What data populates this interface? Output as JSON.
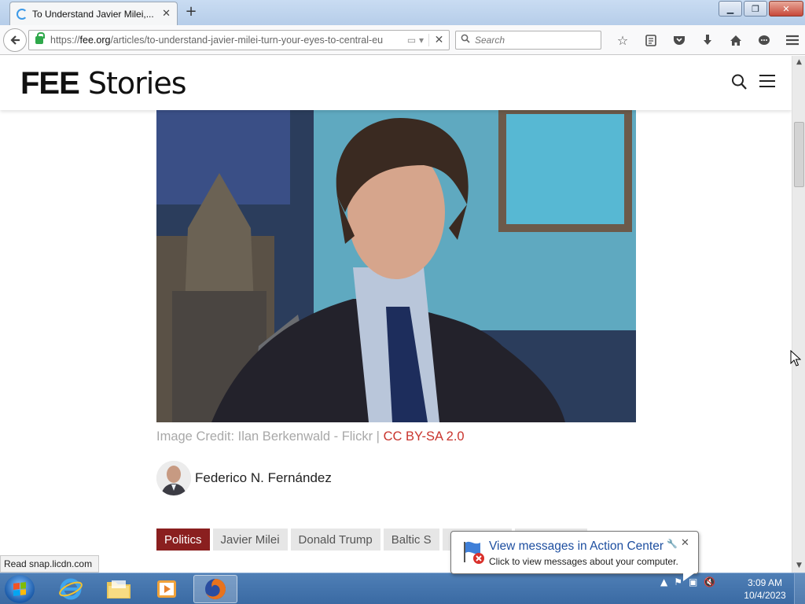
{
  "browser": {
    "tab_title": "To Understand Javier Milei,...",
    "url_prefix": "https://",
    "url_domain": "fee.org",
    "url_path": "/articles/to-understand-javier-milei-turn-your-eyes-to-central-eu",
    "search_placeholder": "Search",
    "status_text": "Read snap.licdn.com"
  },
  "site": {
    "logo_bold": "FEE",
    "logo_light": " Stories"
  },
  "article": {
    "caption_prefix": "Image Credit: Ilan Berkenwald - Flickr | ",
    "caption_license": "CC BY-SA 2.0",
    "author_name": "Federico N. Fernández",
    "tags": [
      "Politics",
      "Javier Milei",
      "Donald Trump",
      "Baltic S"
    ]
  },
  "notification": {
    "title": "View messages in Action Center",
    "text": "Click to view messages about your computer."
  },
  "taskbar": {
    "time": "3:09 AM",
    "date": "10/4/2023"
  },
  "colors": {
    "accent_red": "#c9342d",
    "tag_active": "#8a1f1f",
    "notification_blue": "#1e4fa0"
  }
}
